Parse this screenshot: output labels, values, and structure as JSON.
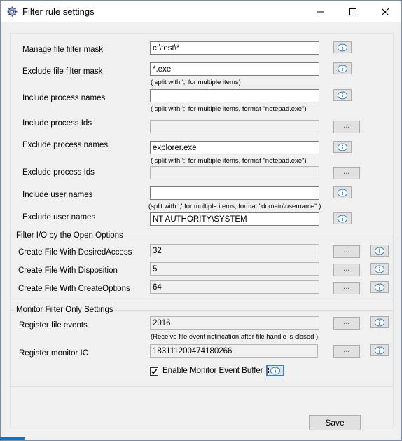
{
  "window": {
    "title": "Filter rule settings",
    "minimize": "—",
    "maximize": "☐",
    "close": "✕"
  },
  "main_fields": [
    {
      "label": "Manage file filter mask",
      "value": "c:\\test\\*",
      "editable": true,
      "hint": "",
      "has_dots": false,
      "has_info": true
    },
    {
      "label": "Exclude file filter mask",
      "value": "*.exe",
      "editable": true,
      "hint": "( split with ';' for multiple items)",
      "has_dots": false,
      "has_info": true
    },
    {
      "label": "Include process names",
      "value": "",
      "editable": true,
      "hint": "( split with ';' for multiple items, format \"notepad.exe\")",
      "has_dots": false,
      "has_info": true
    },
    {
      "label": "Include process Ids",
      "value": "",
      "editable": false,
      "hint": "",
      "has_dots": true,
      "has_info": false
    },
    {
      "label": "Exclude process names",
      "value": "explorer.exe",
      "editable": true,
      "hint": "( split with ';' for multiple items, format \"notepad.exe\")",
      "has_dots": false,
      "has_info": true
    },
    {
      "label": "Exclude process Ids",
      "value": "",
      "editable": false,
      "hint": "",
      "has_dots": true,
      "has_info": false
    },
    {
      "label": "Include user names",
      "value": "",
      "editable": true,
      "hint": "(split with ';' for multiple items, format \"domain\\username\" )",
      "has_dots": false,
      "has_info": true
    },
    {
      "label": "Exclude user names",
      "value": "NT AUTHORITY\\SYSTEM",
      "editable": true,
      "hint": "",
      "has_dots": false,
      "has_info": true
    }
  ],
  "open_options": {
    "legend": "Filter I/O by the Open Options",
    "rows": [
      {
        "label": "Create File With DesiredAccess",
        "value": "32"
      },
      {
        "label": "Create File With Disposition",
        "value": "5"
      },
      {
        "label": "Create File With CreateOptions",
        "value": "64"
      }
    ]
  },
  "monitor": {
    "legend": "Monitor Filter Only Settings",
    "rows": [
      {
        "label": "Register file events",
        "value": "2016",
        "hint": "(Receive file event notification after file handle is closed )"
      },
      {
        "label": "Register monitor IO",
        "value": "183111200474180266",
        "hint": ""
      }
    ],
    "checkbox_label": "Enable Monitor Event Buffer",
    "checkbox_checked": true
  },
  "dots_label": "...",
  "save_label": "Save",
  "colors": {
    "accent": "#0078d7",
    "info_icon": "#3c7fb1"
  }
}
